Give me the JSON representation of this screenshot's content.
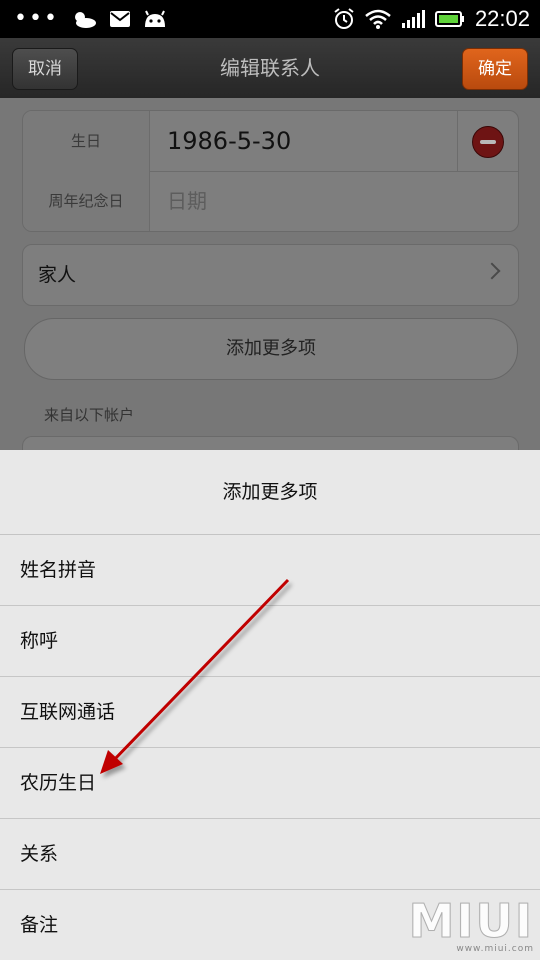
{
  "status_bar": {
    "time": "22:02",
    "icons": [
      "dots-icon",
      "weather-icon",
      "mail-icon",
      "android-icon",
      "alarm-icon",
      "wifi-icon",
      "signal-icon",
      "battery-icon"
    ]
  },
  "title_bar": {
    "cancel_label": "取消",
    "title": "编辑联系人",
    "confirm_label": "确定"
  },
  "form": {
    "birthday_label": "生日",
    "birthday_value": "1986-5-30",
    "anniversary_label": "周年纪念日",
    "anniversary_placeholder": "日期",
    "group_value": "家人",
    "add_more_label": "添加更多项",
    "from_accounts_label": "来自以下帐户"
  },
  "sheet": {
    "title": "添加更多项",
    "items": [
      "姓名拼音",
      "称呼",
      "互联网通话",
      "农历生日",
      "关系",
      "备注"
    ]
  },
  "watermark": {
    "brand": "MIUI",
    "url": "www.miui.com"
  },
  "colors": {
    "confirm_button": "#c85514",
    "annotation_arrow": "#c00000",
    "delete_icon": "#6e1414"
  }
}
